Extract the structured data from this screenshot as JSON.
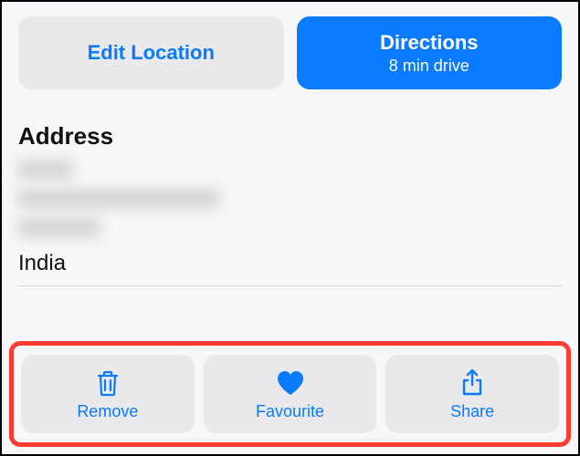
{
  "topButtons": {
    "editLocation": {
      "label": "Edit Location"
    },
    "directions": {
      "title": "Directions",
      "subtitle": "8 min drive"
    }
  },
  "addressSection": {
    "heading": "Address",
    "country": "India"
  },
  "actions": {
    "remove": {
      "label": "Remove",
      "icon": "trash-icon"
    },
    "favourite": {
      "label": "Favourite",
      "icon": "heart-icon"
    },
    "share": {
      "label": "Share",
      "icon": "share-icon"
    }
  },
  "colors": {
    "accent": "#0a7aff",
    "secondaryBg": "#e9e9eb",
    "highlightBorder": "#ff3b30"
  }
}
